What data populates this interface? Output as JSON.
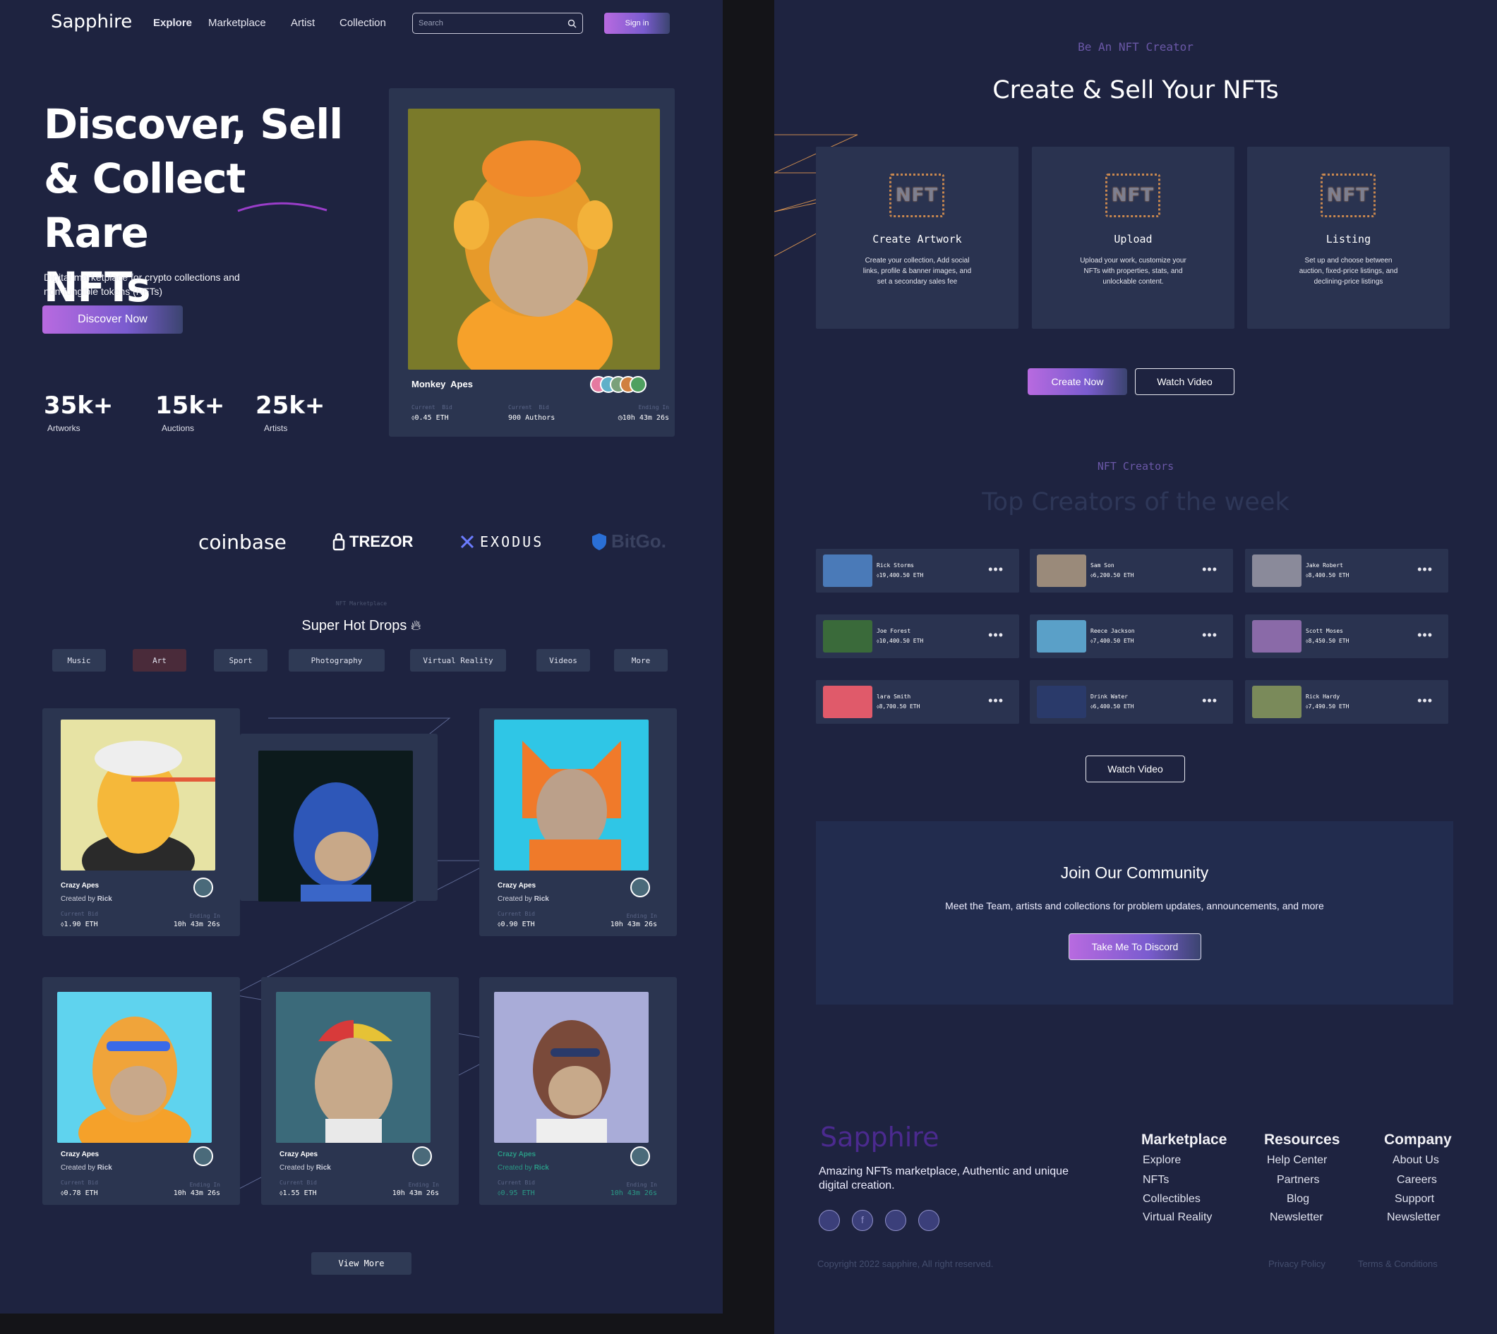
{
  "brand": "Sapphire",
  "nav": {
    "items": [
      "Explore",
      "Marketplace",
      "Artist",
      "Collection"
    ],
    "search_placeholder": "Search",
    "signin": "Sign in"
  },
  "hero": {
    "title_line1": "Discover, Sell",
    "title_line2": "& Collect Rare",
    "title_line3": "NFTs",
    "subtitle_line1": "Digital marketplace for crypto collections and",
    "subtitle_line2": "non-fungible tokens (NFTs)",
    "cta": "Discover Now",
    "stats": [
      {
        "num": "35k+",
        "label": "Artworks"
      },
      {
        "num": "15k+",
        "label": "Auctions"
      },
      {
        "num": "25k+",
        "label": "Artists"
      }
    ]
  },
  "featured": {
    "title": "Monkey  Apes",
    "bid_label": "Current  Bid",
    "bid": "0.45 ETH",
    "authors_label": "Current  Bid",
    "authors": "900 Authors",
    "ending_label": "Ending In",
    "ending": "10h 43m 26s"
  },
  "partners": [
    "coinbase",
    "TREZOR",
    "EXODUS",
    "BitGo."
  ],
  "drops": {
    "eyebrow": "NFT Marketplace",
    "title": "Super Hot Drops",
    "tabs": [
      "Music",
      "Art",
      "Sport",
      "Photography",
      "Virtual Reality",
      "Videos",
      "More"
    ],
    "active_tab": "Art",
    "cards": [
      {
        "name": "Crazy Apes",
        "created_prefix": "Created by",
        "creator": "Rick",
        "bid_label": "Current Bid",
        "bid": "1.90 ETH",
        "end_label": "Ending In",
        "ending": "10h 43m 26s"
      },
      {
        "name": "",
        "created_prefix": "",
        "creator": "",
        "bid_label": "",
        "bid": "",
        "end_label": "",
        "ending": ""
      },
      {
        "name": "Crazy Apes",
        "created_prefix": "Created by",
        "creator": "Rick",
        "bid_label": "Current Bid",
        "bid": "0.90 ETH",
        "end_label": "Ending In",
        "ending": "10h 43m 26s"
      },
      {
        "name": "Crazy Apes",
        "created_prefix": "Created by",
        "creator": "Rick",
        "bid_label": "Current Bid",
        "bid": "0.78 ETH",
        "end_label": "Ending In",
        "ending": "10h 43m 26s"
      },
      {
        "name": "Crazy Apes",
        "created_prefix": "Created by",
        "creator": "Rick",
        "bid_label": "Current Bid",
        "bid": "1.55 ETH",
        "end_label": "Ending In",
        "ending": "10h 43m 26s"
      },
      {
        "name": "Crazy Apes",
        "created_prefix": "Created by",
        "creator": "Rick",
        "bid_label": "Current Bid",
        "bid": "0.95 ETH",
        "end_label": "Ending In",
        "ending": "10h 43m 26s"
      }
    ],
    "view_more": "View More"
  },
  "create": {
    "eyebrow": "Be An NFT Creator",
    "title": "Create & Sell Your NFTs",
    "badge": "NFT",
    "steps": [
      {
        "title": "Create Artwork",
        "l1": "Create your collection, Add social",
        "l2": "links, profile & banner images, and",
        "l3": "set a secondary sales fee"
      },
      {
        "title": "Upload",
        "l1": "Upload your work, customize your",
        "l2": "NFTs with properties, stats, and",
        "l3": "unlockable content."
      },
      {
        "title": "Listing",
        "l1": "Set up and choose between",
        "l2": "auction, fixed-price listings, and",
        "l3": "declining-price listings"
      }
    ],
    "create_btn": "Create Now",
    "watch_btn": "Watch Video"
  },
  "creators": {
    "eyebrow": "NFT Creators",
    "title": "Top Creators of the week",
    "list": [
      {
        "name": "Rick Storms",
        "value": "19,400.50 ETH"
      },
      {
        "name": "Sam Son",
        "value": "6,200.50 ETH"
      },
      {
        "name": "Jake Robert",
        "value": "8,400.50 ETH"
      },
      {
        "name": "Joe Forest",
        "value": "10,400.50 ETH"
      },
      {
        "name": "Reece Jackson",
        "value": "7,400.50 ETH"
      },
      {
        "name": "Scott Moses",
        "value": "8,450.50 ETH"
      },
      {
        "name": "lara Smith",
        "value": "8,700.50 ETH"
      },
      {
        "name": "Drink Water",
        "value": "6,400.50 ETH"
      },
      {
        "name": "Rick Hardy",
        "value": "7,490.50 ETH"
      }
    ],
    "watch_btn": "Watch Video"
  },
  "community": {
    "title": "Join Our Community",
    "text": "Meet the Team, artists and collections for problem updates, announcements, and more",
    "btn": "Take Me To Discord"
  },
  "footer": {
    "brand": "Sapphire",
    "tagline_l1": "Amazing NFTs marketplace, Authentic and unique",
    "tagline_l2": "digital creation.",
    "cols": [
      {
        "title": "Marketplace",
        "links": [
          "Explore",
          "NFTs",
          "Collectibles",
          "Virtual Reality"
        ]
      },
      {
        "title": "Resources",
        "links": [
          "Help Center",
          "Partners",
          "Blog",
          "Newsletter"
        ]
      },
      {
        "title": "Company",
        "links": [
          "About Us",
          "Careers",
          "Support",
          "Newsletter"
        ]
      }
    ],
    "copyright": "Copyright 2022 sapphire, All right reserved.",
    "privacy": "Privacy Policy",
    "terms": "Terms & Conditions"
  },
  "colors": {
    "bg": "#1e2340",
    "card": "#2b3550",
    "accent": "#b86ae0",
    "brand_footer": "#4b2a8f"
  }
}
